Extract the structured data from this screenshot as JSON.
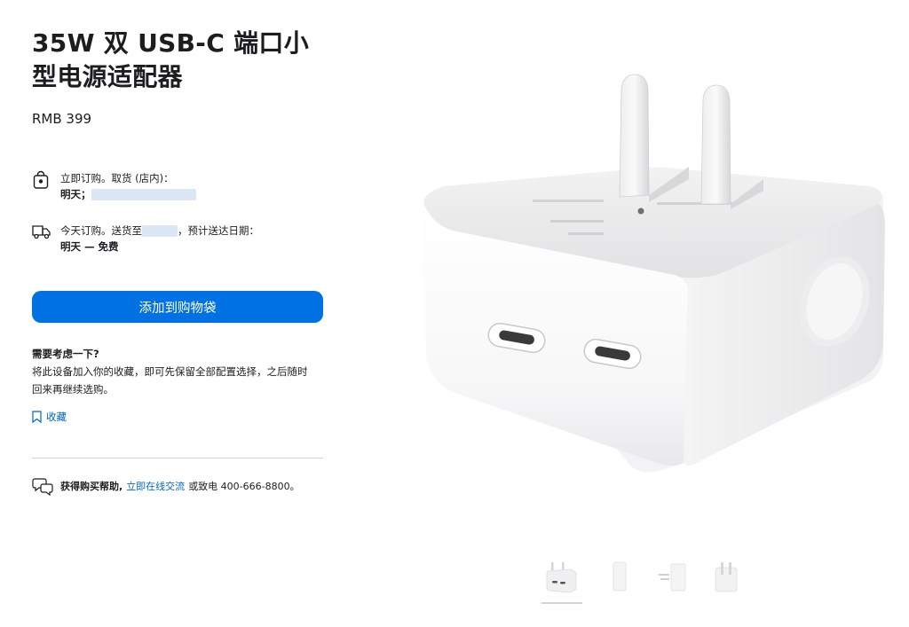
{
  "product": {
    "title": "35W 双 USB-C 端口小型电源适配器",
    "price": "RMB 399"
  },
  "pickup": {
    "line1": "立即订购。取货 (店内)：",
    "line2_bold": "明天；"
  },
  "delivery": {
    "line1_a": "今天订购。送货至",
    "line1_b": "，预计送达日期：",
    "line2_bold": "明天 — 免费"
  },
  "add_to_bag": "添加到购物袋",
  "consider": {
    "title": "需要考虑一下?",
    "body": "将此设备加入你的收藏，即可先保留全部配置选择，之后随时回来再继续选购。",
    "save_label": "收藏"
  },
  "help": {
    "label": "获得购买帮助,",
    "link": "立即在线交流",
    "suffix": "或致电 400-666-8800。"
  },
  "colors": {
    "accent": "#0071e3",
    "link": "#0066cc"
  },
  "icons": [
    "bag-icon",
    "truck-icon",
    "bookmark-icon",
    "chat-icon"
  ]
}
